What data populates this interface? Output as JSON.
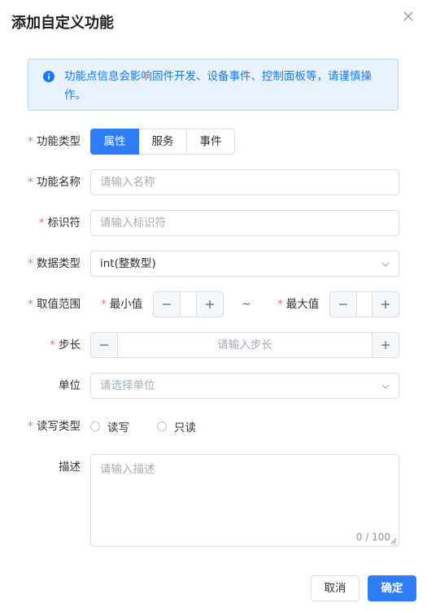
{
  "dialog": {
    "title": "添加自定义功能",
    "alert_text": "功能点信息会影响固件开发、设备事件、控制面板等，请谨慎操作。"
  },
  "form": {
    "function_type": {
      "label": "功能类型",
      "options": [
        "属性",
        "服务",
        "事件"
      ],
      "selected": "属性"
    },
    "function_name": {
      "label": "功能名称",
      "placeholder": "请输入名称"
    },
    "identifier": {
      "label": "标识符",
      "placeholder": "请输入标识符"
    },
    "data_type": {
      "label": "数据类型",
      "value": "int(整数型)"
    },
    "value_range": {
      "label": "取值范围",
      "min_label": "最小值",
      "max_label": "最大值",
      "separator": "~"
    },
    "step": {
      "label": "步长",
      "placeholder": "请输入步长"
    },
    "unit": {
      "label": "单位",
      "placeholder": "请选择单位"
    },
    "rw_type": {
      "label": "读写类型",
      "options": [
        "读写",
        "只读"
      ]
    },
    "description": {
      "label": "描述",
      "placeholder": "请输入描述",
      "counter": "0 / 100"
    }
  },
  "footer": {
    "cancel_label": "取消",
    "confirm_label": "确定"
  },
  "colors": {
    "primary": "#2e7cf6",
    "required": "#f56c6c",
    "alert_bg": "#e8f3ff",
    "alert_text": "#1677ff"
  }
}
